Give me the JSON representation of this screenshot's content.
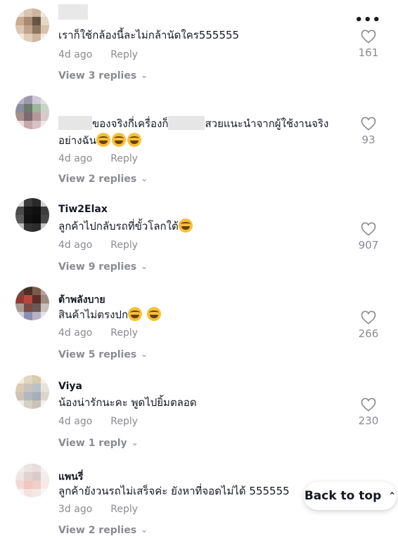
{
  "more_label": "•••",
  "comments": [
    {
      "username": "",
      "text": "เราก็ใช้กล้องนี้ละไม่กล้านัดใคร555555",
      "time": "4d ago",
      "reply_label": "Reply",
      "likes": "161",
      "view_replies": "View 3 replies"
    },
    {
      "username": "",
      "text_line1_a": "ของจริงกี่เครื่องก็",
      "text_line1_b": "สวยแนะนำจากผู้ใช้งานจริง",
      "text_line2": "อย่างฉัน",
      "time": "4d ago",
      "reply_label": "Reply",
      "likes": "93",
      "view_replies": "View 2 replies"
    },
    {
      "username": "Tiw2Elax",
      "text": "ลูกค้าไปกลับรถที่ขั้วโลกใต้",
      "time": "4d ago",
      "reply_label": "Reply",
      "likes": "907",
      "view_replies": "View 9 replies"
    },
    {
      "username": "ต้าพลังบาย",
      "text": "สินค้าไม่ตรงปก",
      "time": "4d ago",
      "reply_label": "Reply",
      "likes": "266",
      "view_replies": "View 5 replies"
    },
    {
      "username": "Viya",
      "text": "น้องน่ารักนะคะ พูดไปยิ้มตลอด",
      "time": "4d ago",
      "reply_label": "Reply",
      "likes": "230",
      "view_replies": "View 1 reply"
    },
    {
      "username": "แพนรี่",
      "text": "ลูกค้ายังวนรถไม่เสร็จค่ะ ยังหาที่จอดไม่ได้ 555555",
      "time": "3d ago",
      "reply_label": "Reply",
      "likes": "",
      "view_replies": "View 2 replies"
    }
  ],
  "back_to_top": "Back to top",
  "colors": {
    "secondary_text": "#8a8b91",
    "primary_text": "#161823"
  }
}
